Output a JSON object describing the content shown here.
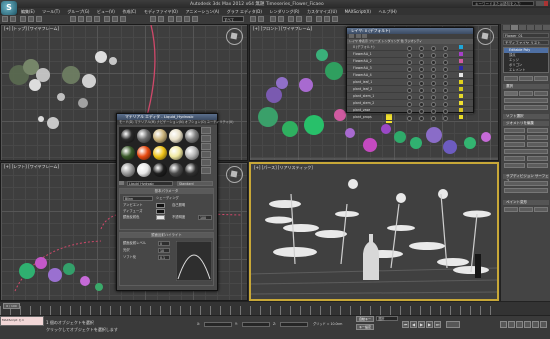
{
  "titlebar": {
    "logo": "S",
    "title": "Autodesk 3ds Max  2012 x64  無題   Timeseries_Flower_Ficaeo",
    "search_placeholder": "キーワードまたは語句を入力"
  },
  "menubar": [
    "編集(E)",
    "ツール(T)",
    "グループ(G)",
    "ビュー(V)",
    "作成(C)",
    "モディファイヤ(O)",
    "アニメーション(A)",
    "グラフ エディタ(D)",
    "レンダリング(R)",
    "カスタマイズ(U)",
    "MAXScript(X)",
    "ヘルプ(H)"
  ],
  "toolbar": {
    "selection_filter": "すべて",
    "view_dropdown": "ビュー"
  },
  "viewports": {
    "top": "[+] [トップ] [ワイヤフレーム]",
    "front": "[+] [フロント] [ワイヤフレーム]",
    "left": "[+] [レフト] [ワイヤフレーム]",
    "perspective": "[+] [パース] [リアリスティック]"
  },
  "material_editor": {
    "title": "マテリアル エディタ - Liquid_Hydrosic",
    "menu": "モード(D)  マテリアル(M)  ナビゲーション(N)  オプション(O)  ユーティリティ(U)",
    "material_name": "Liquid_Hydrosic",
    "material_type": "Standard",
    "rollout_basic": "基本パラメータ",
    "shader": "Blinn",
    "shader_label": "シェーディング",
    "params": [
      {
        "label": "アンビエント",
        "value": ""
      },
      {
        "label": "ディフューズ",
        "value": ""
      },
      {
        "label": "鏡面反射色",
        "value": ""
      }
    ],
    "selfillum_label": "自己照明",
    "opacity_label": "不透明度",
    "opacity_value": "100",
    "rollout_spec": "鏡面反射ハイライト",
    "spec_level_label": "鏡面反射レベル",
    "spec_level": "0",
    "gloss_label": "光沢",
    "gloss": "10",
    "soften_label": "ソフト化",
    "soften": "0.1",
    "slot_colors": [
      "#2a2a2a",
      "#6a6a6a",
      "#c9b27a",
      "#e8e0c8",
      "#7e7e7e",
      "#3a5a2a",
      "#e84a10",
      "#f0c418",
      "#f0e8a0",
      "#b4b4b4",
      "#9a9a9a",
      "#e8e8e8",
      "#1e1e1e",
      "#4a4a4a",
      "#303030"
    ]
  },
  "layer_dialog": {
    "title": "レイヤ: 0 (デフォルト)",
    "columns": "レイヤ  非表示  フリーズ  レンダリング  色  ラジオシティ",
    "rows": [
      {
        "name": "0 (デフォルト)",
        "color": "#1ea6d8"
      },
      {
        "name": "FlowerAA_1",
        "color": "#a640c8"
      },
      {
        "name": "FlowerAA_2",
        "color": "#d05aa0"
      },
      {
        "name": "FlowerAA_3",
        "color": "#2a2aa6"
      },
      {
        "name": "FlowerAA_4",
        "color": "#e6e6e6"
      },
      {
        "name": "plant_leaf_1",
        "color": "#e2d21c"
      },
      {
        "name": "plant_leaf_2",
        "color": "#d2c81a"
      },
      {
        "name": "plant_stem_1",
        "color": "#e4d82a"
      },
      {
        "name": "plant_stem_2",
        "color": "#f0e030"
      },
      {
        "name": "plant_vase",
        "color": "#d8c620"
      },
      {
        "name": "plant_props",
        "color": "#e8dc28"
      }
    ]
  },
  "command_panel": {
    "object_name": "Flower_01",
    "modifier_list": "モディファイヤ リスト",
    "stack": [
      "Editable Poly",
      "頂点",
      "エッジ",
      "ポリゴン",
      "エレメント"
    ],
    "rollouts": [
      "選択",
      "ソフト選択",
      "ジオメトリを編集",
      "サブディビジョン サーフェス",
      "ペイント変形"
    ]
  },
  "timeline": {
    "frame": "0 / 100"
  },
  "status": {
    "maxscript": "MAXScript ミニ",
    "line1": "1 個のオブジェクトを選択",
    "line2": "クリックしてオブジェクトを選択します",
    "x": "X:",
    "y": "Y:",
    "z": "Z:",
    "grid": "グリッド = 10.0cm",
    "autokey": "自動キー",
    "setkey": "キー設定",
    "selected": "選択"
  }
}
